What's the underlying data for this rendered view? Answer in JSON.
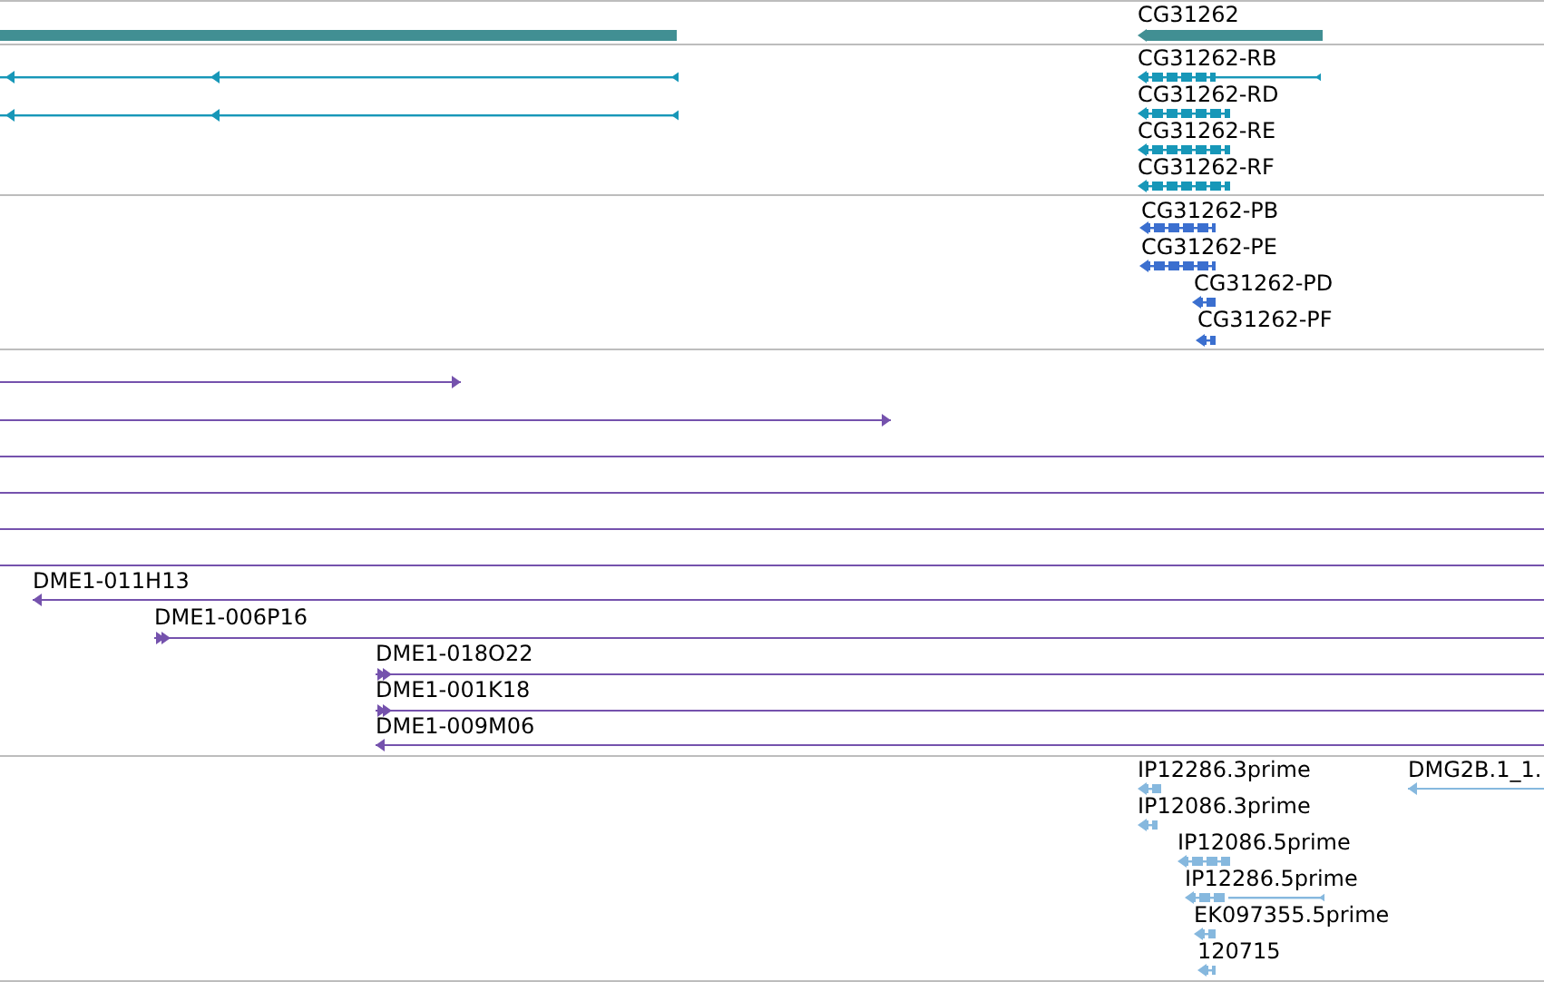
{
  "tracks": [
    {
      "kind": "gene",
      "features": [
        {
          "reverse": true
        },
        {
          "label": "CG31262",
          "reverse": true
        }
      ]
    },
    {
      "kind": "transcript",
      "features": [
        {
          "reverse": true
        },
        {
          "reverse": true
        },
        {
          "label": "CG31262-RB",
          "reverse": true
        },
        {
          "label": "CG31262-RD",
          "reverse": true
        },
        {
          "label": "CG31262-RE",
          "reverse": true
        },
        {
          "label": "CG31262-RF",
          "reverse": true
        }
      ]
    },
    {
      "kind": "protein",
      "features": [
        {
          "label": "CG31262-PB",
          "reverse": true
        },
        {
          "label": "CG31262-PE",
          "reverse": true
        },
        {
          "label": "CG31262-PD",
          "reverse": true
        },
        {
          "label": "CG31262-PF",
          "reverse": true
        }
      ]
    },
    {
      "kind": "clone",
      "features": [
        {
          "reverse": false
        },
        {
          "reverse": false
        },
        {
          "reverse": true
        },
        {
          "reverse": true
        },
        {
          "reverse": true
        },
        {
          "reverse": true
        },
        {
          "label": "DME1-011H13",
          "reverse": true
        },
        {
          "label": "DME1-006P16",
          "reverse": false
        },
        {
          "label": "DME1-018O22",
          "reverse": false
        },
        {
          "label": "DME1-001K18",
          "reverse": false
        },
        {
          "label": "DME1-009M06",
          "reverse": true
        }
      ]
    },
    {
      "kind": "est",
      "features": [
        {
          "label": "IP12286.3prime",
          "reverse": true
        },
        {
          "label": "DMG2B.1_1.",
          "reverse": true
        },
        {
          "label": "IP12086.3prime",
          "reverse": true
        },
        {
          "label": "IP12086.5prime",
          "reverse": true
        },
        {
          "label": "IP12286.5prime",
          "reverse": true
        },
        {
          "label": "EK097355.5prime",
          "reverse": true
        },
        {
          "label": "120715",
          "reverse": true
        }
      ]
    }
  ]
}
